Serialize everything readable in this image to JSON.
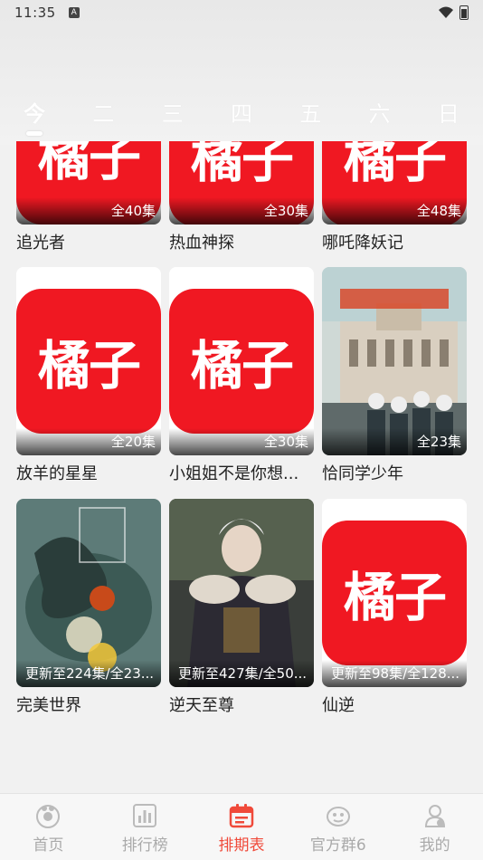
{
  "status_bar": {
    "time": "11:35",
    "notification_icon": "A"
  },
  "weekdays": [
    "今",
    "二",
    "三",
    "四",
    "五",
    "六",
    "日"
  ],
  "active_weekday": 0,
  "logo_text": "橘子",
  "items": [
    {
      "title": "追光者",
      "badge": "全40集",
      "image": "orange-logo"
    },
    {
      "title": "热血神探",
      "badge": "全30集",
      "image": "orange-logo"
    },
    {
      "title": "哪吒降妖记",
      "badge": "全48集",
      "image": "orange-logo"
    },
    {
      "title": "放羊的星星",
      "badge": "全20集",
      "image": "orange-logo"
    },
    {
      "title": "小姐姐不是你想...",
      "badge": "全30集",
      "image": "orange-logo"
    },
    {
      "title": "恰同学少年",
      "badge": "全23集",
      "image": "poster-school"
    },
    {
      "title": "完美世界",
      "badge": "更新至224集/全23...",
      "image": "poster-dragon"
    },
    {
      "title": "逆天至尊",
      "badge": "更新至427集/全50...",
      "image": "poster-warrior"
    },
    {
      "title": "仙逆",
      "badge": "更新至98集/全128...",
      "image": "orange-logo"
    }
  ],
  "bottom_tabs": [
    {
      "label": "首页",
      "icon": "home-icon"
    },
    {
      "label": "排行榜",
      "icon": "ranking-icon"
    },
    {
      "label": "排期表",
      "icon": "calendar-icon"
    },
    {
      "label": "官方群6",
      "icon": "group-icon"
    },
    {
      "label": "我的",
      "icon": "profile-icon"
    }
  ],
  "active_tab": 2,
  "colors": {
    "accent": "#f04a3a",
    "logo_red": "#f01822",
    "inactive": "#aaaaaa"
  }
}
